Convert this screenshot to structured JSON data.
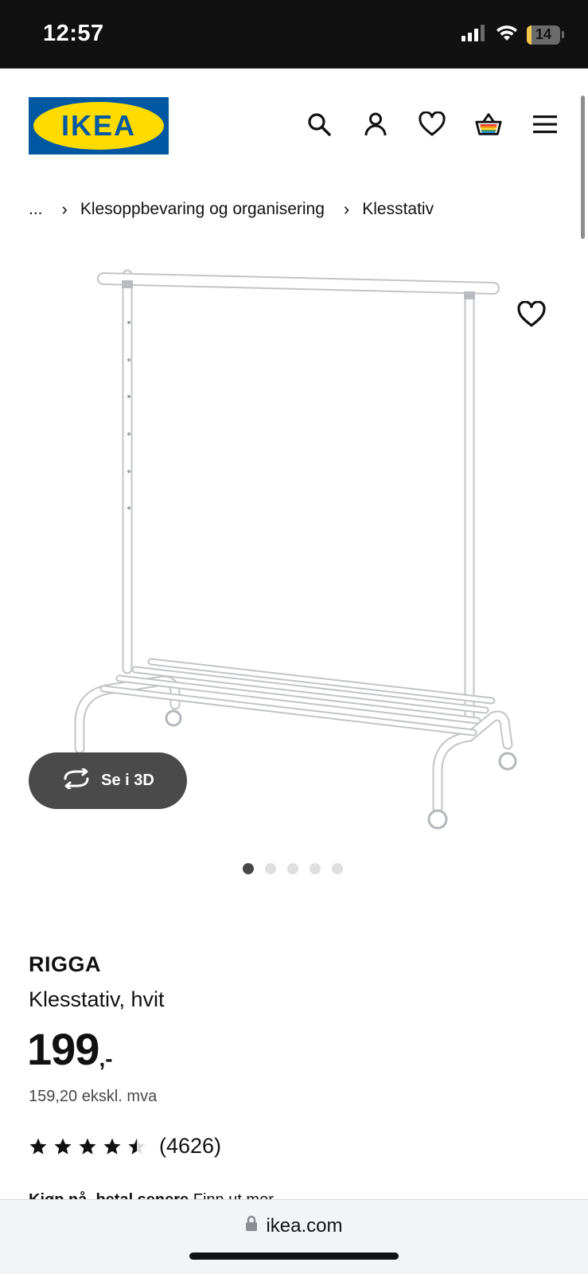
{
  "status_bar": {
    "time": "12:57",
    "battery_level": "14",
    "icons": [
      "signal-icon",
      "wifi-icon",
      "battery-icon"
    ]
  },
  "header": {
    "logo_text": "IKEA",
    "icons": [
      "search-icon",
      "account-icon",
      "heart-icon",
      "shopping-basket-icon",
      "menu-icon"
    ]
  },
  "breadcrumb": {
    "ellipsis": "...",
    "items": [
      "Klesoppbevaring og organisering",
      "Klesstativ"
    ]
  },
  "gallery": {
    "view_3d_label": "Se i 3D",
    "total_images": 5,
    "active_index": 0
  },
  "product": {
    "name": "RIGGA",
    "description": "Klesstativ, hvit",
    "price_integer": "199",
    "price_decimals": ",-",
    "price_excl_vat": "159,20 ekskl. mva",
    "rating_value": 4.5,
    "rating_max": 5,
    "review_count": "(4626)"
  },
  "promo": {
    "strong": "Kjøp nå, betal senere",
    "link": "Finn ut mer"
  },
  "browser": {
    "url": "ikea.com"
  },
  "colors": {
    "ikea_blue": "#0058a3",
    "ikea_yellow": "#ffdb00",
    "button_dark": "#4a4a4a"
  }
}
